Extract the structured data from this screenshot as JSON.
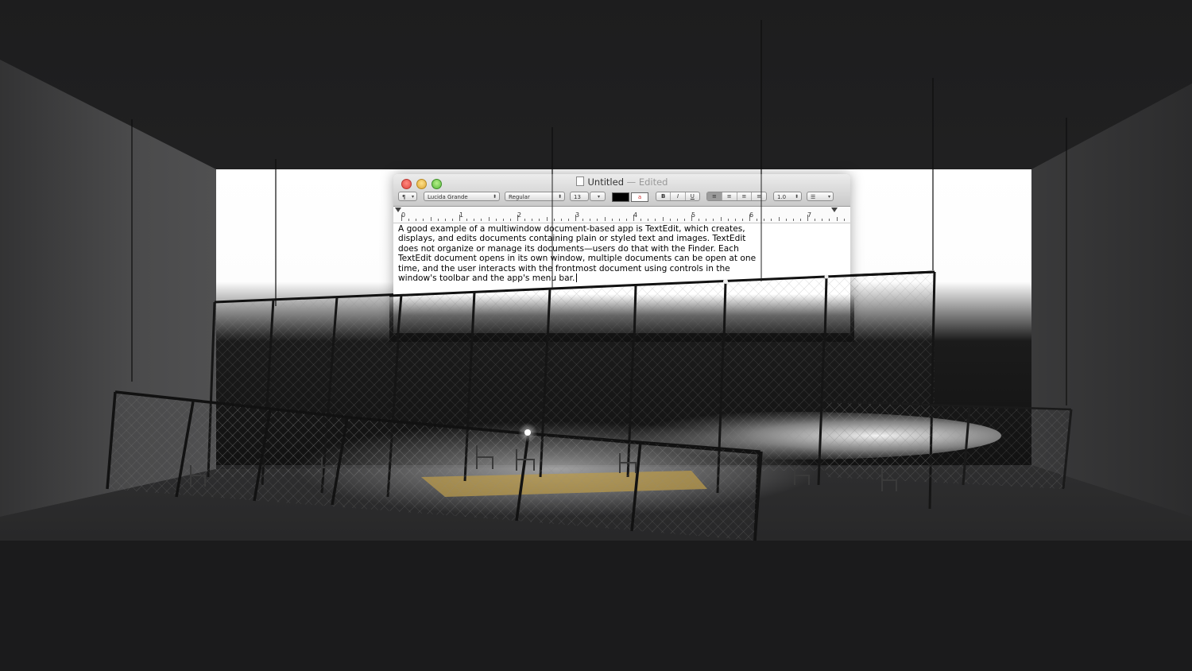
{
  "window": {
    "title": "Untitled",
    "title_suffix": "— Edited",
    "close_icon": "close-icon",
    "minimize_icon": "minimize-icon",
    "zoom_icon": "zoom-icon"
  },
  "toolbar": {
    "paragraph": "¶",
    "font_family": "Lucida Grande",
    "font_style": "Regular",
    "font_size": "13",
    "bold": "B",
    "italic": "I",
    "underline": "U",
    "line_spacing": "1.0",
    "list_icon": "list-icon",
    "text_color": "#000000"
  },
  "ruler": {
    "numbers": [
      "0",
      "1",
      "2",
      "3",
      "4",
      "5",
      "6",
      "7"
    ]
  },
  "document": {
    "lines": [
      "A good example of a multiwindow document-based app is TextEdit, which creates,",
      "displays, and edits documents containing plain or styled text and images. TextEdit",
      "does not organize or manage its documents—users do that with the Finder. Each",
      "TextEdit document opens in its own window, multiple documents can be open at one",
      "time, and the user interacts with the frontmost document using controls in the",
      "window's toolbar and the app's menu bar."
    ]
  }
}
